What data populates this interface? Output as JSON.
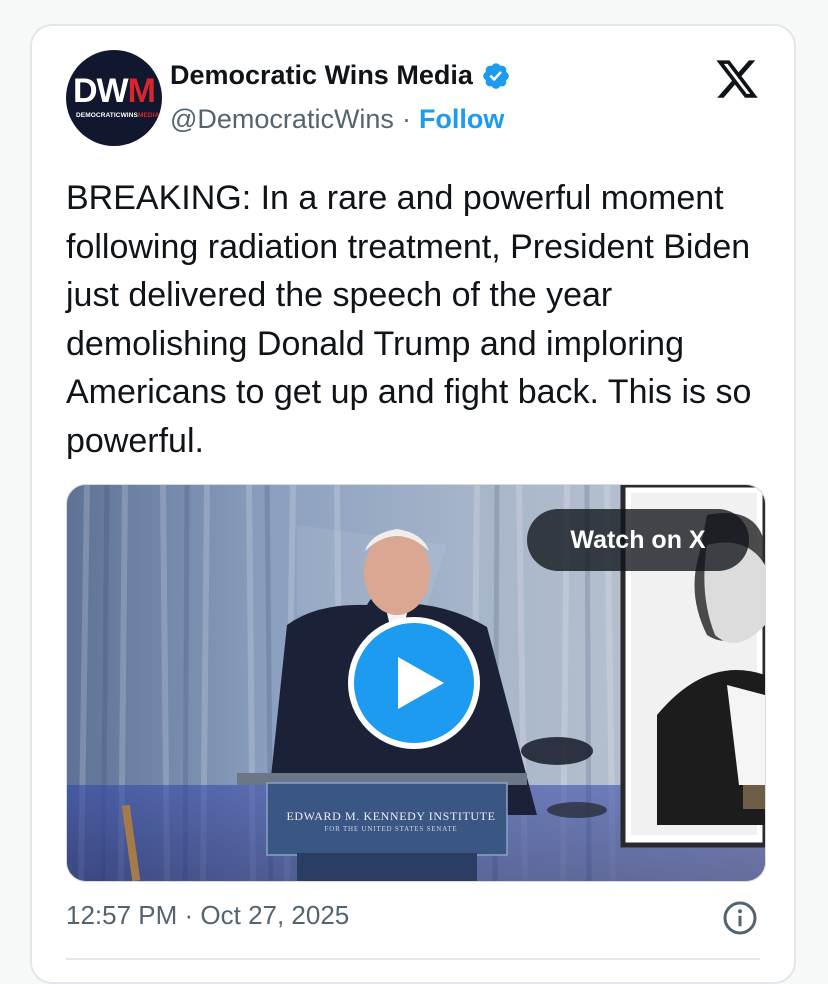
{
  "author": {
    "display_name": "Democratic Wins Media",
    "handle": "@DemocraticWins",
    "separator": "·",
    "follow_label": "Follow",
    "avatar": {
      "logo_text_white": "DW",
      "logo_text_red": "M",
      "logo_sub_white": "DEMOCRATICWINS",
      "logo_sub_red": "MEDIA"
    },
    "verified_icon": "verified-badge-icon"
  },
  "tweet": {
    "text": "BREAKING: In a rare and powerful moment following radiation treatment, President Biden just delivered the speech of the year demolishing Donald Trump and imploring Americans to get up and fight back. This is so powerful."
  },
  "media": {
    "watch_label": "Watch on X",
    "play_icon": "play-icon",
    "podium_text": "EDWARD M. KENNEDY INSTITUTE",
    "podium_subtext": "FOR THE UNITED STATES SENATE"
  },
  "footer": {
    "timestamp": "12:57 PM · Oct 27, 2025",
    "info_icon": "info-icon"
  },
  "colors": {
    "accent": "#1d9bf0",
    "text": "#0f1419",
    "muted": "#536471",
    "brand_red": "#d9252c"
  }
}
